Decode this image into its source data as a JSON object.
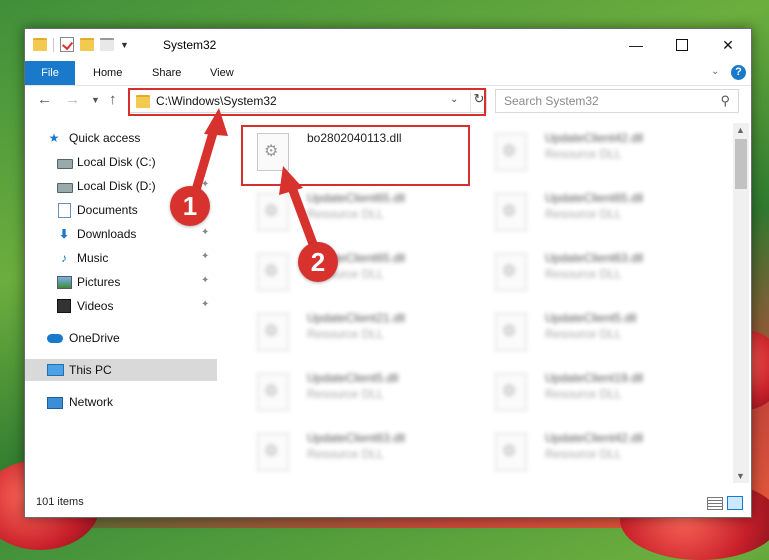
{
  "window": {
    "title": "System32",
    "minimize_glyph": "—",
    "close_glyph": "✕"
  },
  "ribbon": {
    "tabs": [
      {
        "label": "File"
      },
      {
        "label": "Home"
      },
      {
        "label": "Share"
      },
      {
        "label": "View"
      }
    ],
    "help": "?"
  },
  "address": {
    "path": "C:\\Windows\\System32",
    "search_placeholder": "Search System32"
  },
  "sidebar": {
    "items": [
      {
        "label": "Quick access",
        "icon": "star-icon"
      },
      {
        "label": "Local Disk (C:)",
        "icon": "disk-icon"
      },
      {
        "label": "Local Disk (D:)",
        "icon": "disk-icon"
      },
      {
        "label": "Documents",
        "icon": "document-icon"
      },
      {
        "label": "Downloads",
        "icon": "download-icon"
      },
      {
        "label": "Music",
        "icon": "music-icon"
      },
      {
        "label": "Pictures",
        "icon": "pictures-icon"
      },
      {
        "label": "Videos",
        "icon": "video-icon"
      },
      {
        "label": "OneDrive",
        "icon": "cloud-icon"
      },
      {
        "label": "This PC",
        "icon": "computer-icon",
        "selected": true
      },
      {
        "label": "Network",
        "icon": "network-icon"
      }
    ]
  },
  "files": {
    "highlighted": {
      "name": "bo2802040113.dll"
    },
    "left_column": [
      {
        "name": "UpdateClient65.dll",
        "type": "Resource DLL"
      },
      {
        "name": "UpdateClient65.dll",
        "type": "Resource DLL"
      },
      {
        "name": "UpdateClient21.dll",
        "type": "Resource DLL"
      },
      {
        "name": "UpdateClient5.dll",
        "type": "Resource DLL"
      },
      {
        "name": "UpdateClient63.dll",
        "type": "Resource DLL"
      }
    ],
    "right_column": [
      {
        "name": "UpdateClient42.dll",
        "type": "Resource DLL"
      },
      {
        "name": "UpdateClient65.dll",
        "type": "Resource DLL"
      },
      {
        "name": "UpdateClient63.dll",
        "type": "Resource DLL"
      },
      {
        "name": "UpdateClient5.dll",
        "type": "Resource DLL"
      },
      {
        "name": "UpdateClient19.dll",
        "type": "Resource DLL"
      },
      {
        "name": "UpdateClient42.dll",
        "type": "Resource DLL"
      }
    ]
  },
  "status": {
    "item_count": "101 items"
  },
  "annotations": {
    "badge1": "1",
    "badge2": "2",
    "color": "#d7322d"
  }
}
